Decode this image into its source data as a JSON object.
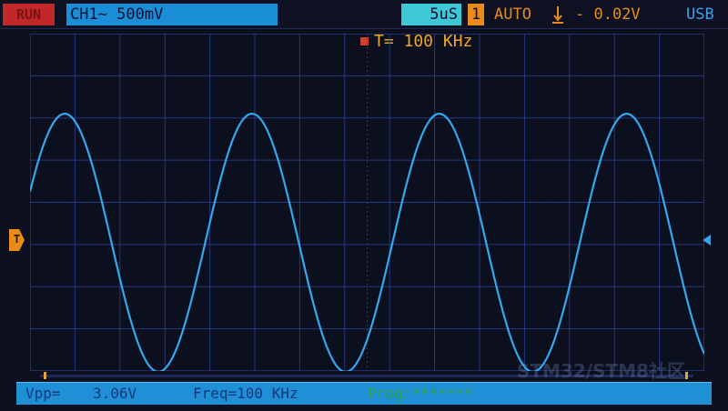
{
  "top_bar": {
    "run_status": "RUN",
    "channel_info": "CH1~ 500mV",
    "timebase": "5uS",
    "mode_number": "1",
    "trigger_mode": "AUTO",
    "trigger_edge_icon": "falling-edge-icon",
    "trigger_level": "- 0.02V",
    "connection": "USB"
  },
  "frequency_banner": {
    "text": "T= 100  KHz"
  },
  "markers": {
    "trigger_label": "T"
  },
  "status_bar": {
    "vpp_label": "Vpp=",
    "vpp_value": "3.06V",
    "freq_text": "Freq=100  KHz",
    "progress_text": "Prog:*******"
  },
  "watermark": "STM32/STM8社区",
  "colors": {
    "trace": "#33a8ee",
    "grid": "#2a3c8c",
    "accent_orange": "#e98b1a",
    "channel_blue": "#1b8ed8"
  },
  "waveform": {
    "type": "sine",
    "frequency_khz": 100,
    "vpp_volts": 3.06,
    "volts_per_div": 0.5,
    "time_per_div_us": 5,
    "visible_periods": 3.6
  }
}
